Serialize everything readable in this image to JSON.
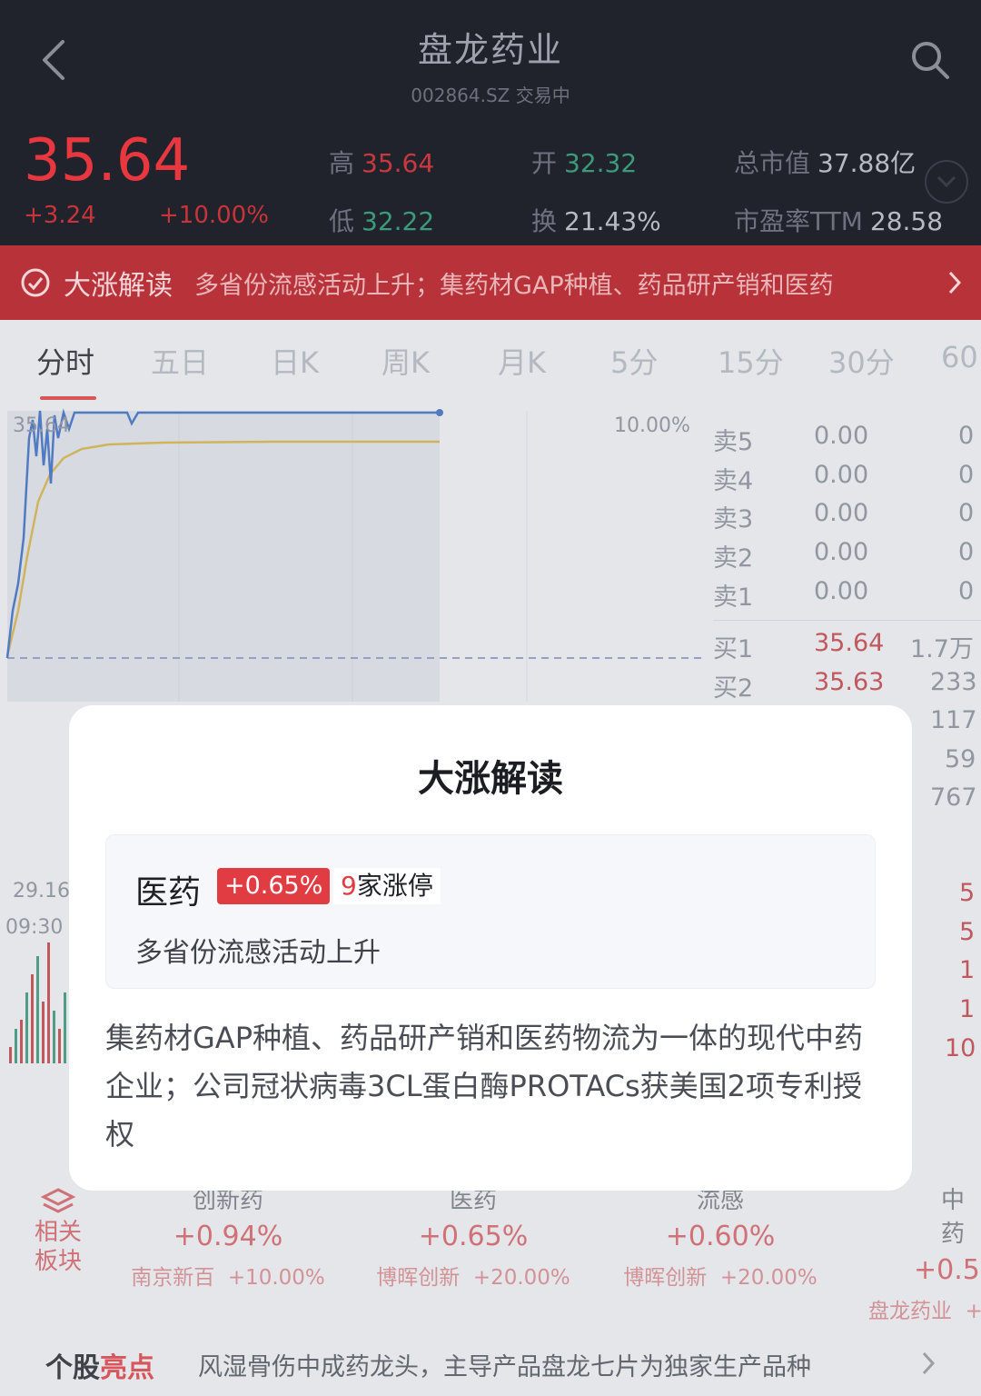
{
  "header": {
    "title": "盘龙药业",
    "subtitle": "002864.SZ 交易中",
    "price": "35.64",
    "change_abs": "+3.24",
    "change_pct": "+10.00%",
    "stats": [
      {
        "label": "高",
        "value": "35.64"
      },
      {
        "label": "低",
        "value": "32.22"
      },
      {
        "label": "开",
        "value": "32.32"
      },
      {
        "label": "换",
        "value": "21.43%"
      },
      {
        "label": "总市值",
        "value": "37.88亿"
      },
      {
        "label": "市盈率TTM",
        "value": "28.58"
      }
    ]
  },
  "banner": {
    "title": "大涨解读",
    "text": "多省份流感活动上升；集药材GAP种植、药品研产销和医药"
  },
  "tabs": [
    "分时",
    "五日",
    "日K",
    "周K",
    "月K",
    "5分",
    "15分",
    "30分",
    "60"
  ],
  "chart": {
    "price_top": "35.64",
    "pct_top": "10.00%",
    "price_bottom": "29.16",
    "time_start": "09:30"
  },
  "order_book": {
    "asks": [
      {
        "label": "卖5",
        "price": "0.00",
        "vol": "0"
      },
      {
        "label": "卖4",
        "price": "0.00",
        "vol": "0"
      },
      {
        "label": "卖3",
        "price": "0.00",
        "vol": "0"
      },
      {
        "label": "卖2",
        "price": "0.00",
        "vol": "0"
      },
      {
        "label": "卖1",
        "price": "0.00",
        "vol": "0"
      }
    ],
    "bids": [
      {
        "label": "买1",
        "price": "35.64",
        "vol": "1.7万"
      },
      {
        "label": "买2",
        "price": "35.63",
        "vol": "233"
      },
      {
        "label": "",
        "price": "",
        "vol": "117"
      },
      {
        "label": "",
        "price": "",
        "vol": "59"
      },
      {
        "label": "",
        "price": "",
        "vol": "767"
      }
    ],
    "ticks": [
      "5",
      "5",
      "1",
      "1",
      "10"
    ]
  },
  "related": {
    "label": "相关板块",
    "sectors": [
      {
        "name": "创新药",
        "pct": "+0.94%",
        "leader": "南京新百",
        "leader_pct": "+10.00%"
      },
      {
        "name": "医药",
        "pct": "+0.65%",
        "leader": "博晖创新",
        "leader_pct": "+20.00%"
      },
      {
        "name": "流感",
        "pct": "+0.60%",
        "leader": "博晖创新",
        "leader_pct": "+20.00%"
      },
      {
        "name": "中药",
        "pct": "+0.5",
        "leader": "盘龙药业",
        "leader_pct": "+"
      }
    ]
  },
  "footer": {
    "brand_a": "个股",
    "brand_b": "亮点",
    "text": "风湿骨伤中成药龙头，主导产品盘龙七片为独家生产品种"
  },
  "modal": {
    "title": "大涨解读",
    "sector": "医药",
    "sector_pct": "+0.65%",
    "limit_count": "9",
    "limit_text": "家涨停",
    "reason": "多省份流感活动上升",
    "description": "集药材GAP种植、药品研产销和医药物流为一体的现代中药企业；公司冠状病毒3CL蛋白酶PROTACs获美国2项专利授权"
  },
  "colors": {
    "up": "#e23c43",
    "header_bg": "#20232c",
    "banner_bg": "#b8323a"
  }
}
